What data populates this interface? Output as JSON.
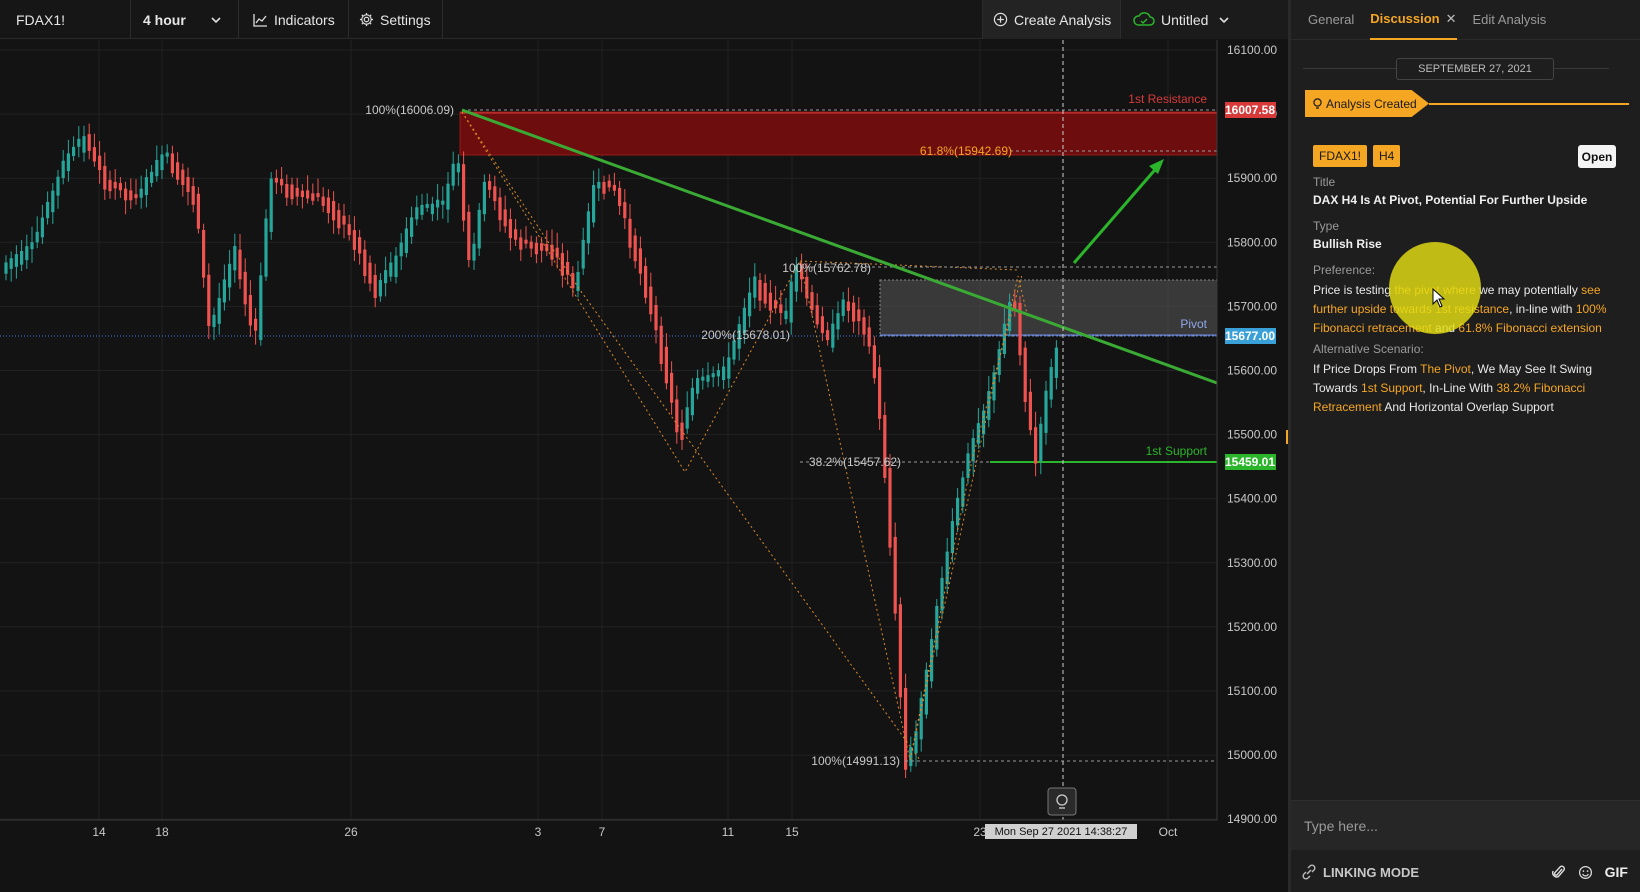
{
  "toolbar": {
    "symbol": "FDAX1!",
    "interval": "4 hour",
    "indicators_label": "Indicators",
    "settings_label": "Settings",
    "create_analysis_label": "Create Analysis",
    "layout_name": "Untitled"
  },
  "chart": {
    "price_ticks": [
      "16100.00",
      "16000.00",
      "15900.00",
      "15800.00",
      "15700.00",
      "15600.00",
      "15500.00",
      "15400.00",
      "15300.00",
      "15200.00",
      "15100.00",
      "15000.00",
      "14900.00"
    ],
    "date_ticks": [
      "14",
      "18",
      "26",
      "3",
      "7",
      "11",
      "15",
      "23",
      "Oct"
    ],
    "crosshair_time": "Mon Sep 27 2021 14:38:27",
    "resistance": {
      "label": "1st Resistance",
      "price": "16007.58",
      "color": "#d83a3a"
    },
    "pivot": {
      "label": "Pivot",
      "price": "15677.00",
      "color": "#3a8fd8"
    },
    "support": {
      "label": "1st Support",
      "price": "15459.01",
      "color": "#2bb52b"
    },
    "fib_labels": {
      "top_left": "100%(16006.09)",
      "fib_618": "61.8%(15942.69)",
      "mid_top": "100%(15762.78)",
      "fib_200": "200%(15678.01)",
      "fib_382": "38.2%(15457.62)",
      "bottom": "100%(14991.13)"
    },
    "colors": {
      "up": "#26a69a",
      "down": "#ef5350",
      "trendline": "#3aaa35",
      "fib": "#d98b2b"
    }
  },
  "panel": {
    "tabs": [
      "General",
      "Discussion",
      "Edit Analysis"
    ],
    "active_tab": "Discussion",
    "date": "SEPTEMBER 27, 2021",
    "event": "Analysis Created",
    "tags": [
      "FDAX1!",
      "H4"
    ],
    "open_label": "Open",
    "title_label": "Title",
    "title": "DAX H4 Is At Pivot, Potential For Further Upside",
    "type_label": "Type",
    "type": "Bullish Rise",
    "preference_label": "Preference:",
    "preference_parts": [
      {
        "t": "Price is testing ",
        "h": false
      },
      {
        "t": "the pivot where",
        "h": true
      },
      {
        "t": " we may potentially ",
        "h": false
      },
      {
        "t": "see further upside towards 1st resistance",
        "h": true
      },
      {
        "t": ", in-line with ",
        "h": false
      },
      {
        "t": "100% Fibonacci retracement",
        "h": true
      },
      {
        "t": " and ",
        "h": false
      },
      {
        "t": "61.8% Fibonacci extension",
        "h": true
      }
    ],
    "alt_label": "Alternative Scenario:",
    "alt_parts": [
      {
        "t": "If Price Drops From ",
        "h": false
      },
      {
        "t": "The Pivot",
        "h": true
      },
      {
        "t": ", We May See It Swing Towards ",
        "h": false
      },
      {
        "t": "1st Support",
        "h": true
      },
      {
        "t": ", In-Line With ",
        "h": false
      },
      {
        "t": "38.2% Fibonacci Retracement",
        "h": true
      },
      {
        "t": " And Horizontal Overlap Support",
        "h": false
      }
    ],
    "reply_placeholder": "Type here...",
    "linking_mode": "LINKING MODE",
    "gif_label": "GIF",
    "accent": "#f5a623"
  }
}
